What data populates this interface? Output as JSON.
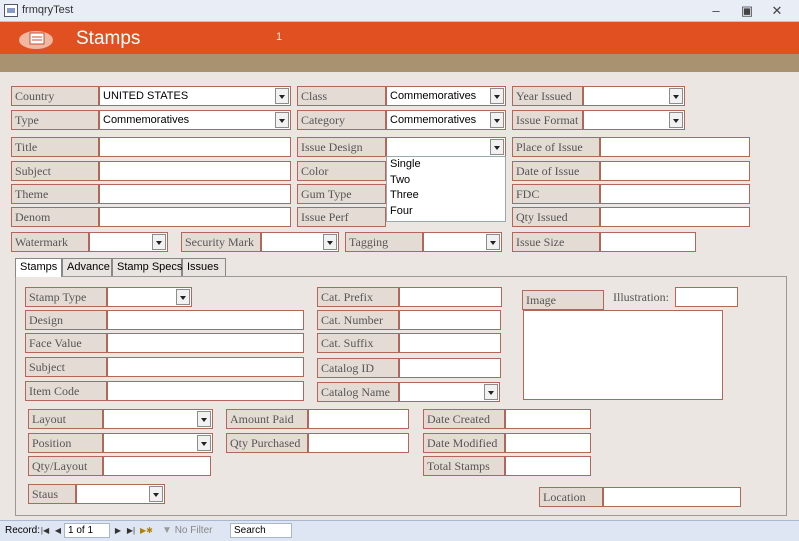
{
  "window": {
    "title": "frmqryTest",
    "minimize_icon": "minimize-icon",
    "maximize_icon": "maximize-icon",
    "close_icon": "close-icon"
  },
  "header": {
    "title": "Stamps",
    "number": "1",
    "color": "#e05020",
    "band_color": "#a89270"
  },
  "labels": {
    "country": "Country",
    "class": "Class",
    "year_issued": "Year Issued",
    "type": "Type",
    "category": "Category",
    "issue_format": "Issue Format",
    "title": "Title",
    "issue_design": "Issue Design",
    "place_of_issue": "Place of Issue",
    "subject": "Subject",
    "color": "Color",
    "date_of_issue": "Date of Issue",
    "theme": "Theme",
    "gum_type": "Gum Type",
    "fdc": "FDC",
    "denom": "Denom",
    "issue_perf": "Issue Perf",
    "qty_issued": "Qty Issued",
    "watermark": "Watermark",
    "security_mark": "Security Mark",
    "tagging": "Tagging",
    "issue_size": "Issue Size"
  },
  "values": {
    "country": "UNITED STATES",
    "class": "Commemoratives",
    "type": "Commemoratives",
    "category": "Commemoratives"
  },
  "issue_design_options": [
    "Single",
    "Two",
    "Three",
    "Four"
  ],
  "tabs": [
    "Stamps",
    "Advance",
    "Stamp Specs",
    "Issues"
  ],
  "stamps_tab": {
    "stamp_type": "Stamp Type",
    "design": "Design",
    "face_value": "Face Value",
    "subject": "Subject",
    "item_code": "Item Code",
    "cat_prefix": "Cat. Prefix",
    "cat_number": "Cat. Number",
    "cat_suffix": "Cat. Suffix",
    "catalog_id": "Catalog ID",
    "catalog_name": "Catalog Name",
    "image": "Image",
    "illustration": "Illustration:",
    "layout": "Layout",
    "position": "Position",
    "qty_layout": "Qty/Layout",
    "staus": "Staus",
    "amount_paid": "Amount Paid",
    "qty_purchased": "Qty Purchased",
    "date_created": "Date Created",
    "date_modified": "Date Modified",
    "total_stamps": "Total Stamps",
    "location": "Location"
  },
  "statusbar": {
    "record_label": "Record:",
    "record_value": "1 of 1",
    "filter": "No Filter",
    "search": "Search"
  }
}
